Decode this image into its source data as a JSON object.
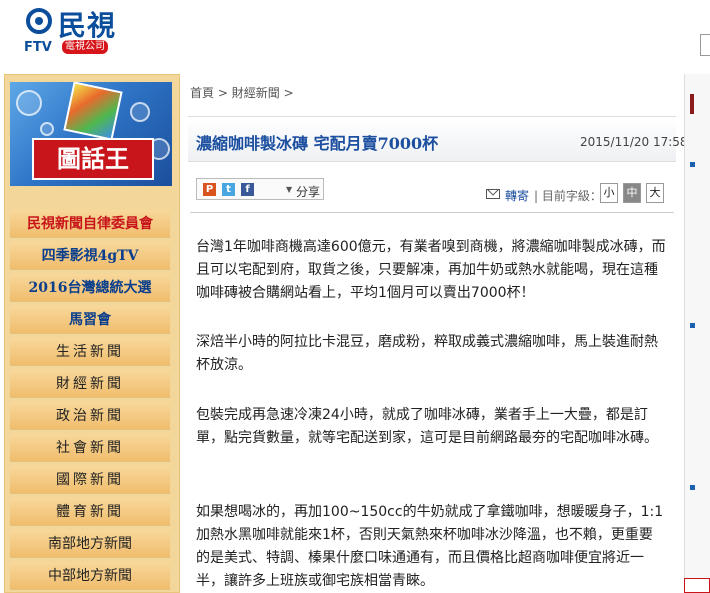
{
  "header": {
    "logo_text": "民視",
    "logo_ftv": "FTV",
    "logo_company": "電視公司"
  },
  "sidebar": {
    "banner_label": "圖話王",
    "items": [
      {
        "label": "民視新聞自律委員會"
      },
      {
        "label": "四季影視4gTV"
      },
      {
        "label": "2016台灣總統大選"
      },
      {
        "label": "馬習會"
      },
      {
        "label": "生活新聞"
      },
      {
        "label": "財經新聞"
      },
      {
        "label": "政治新聞"
      },
      {
        "label": "社會新聞"
      },
      {
        "label": "國際新聞"
      },
      {
        "label": "體育新聞"
      },
      {
        "label": "南部地方新聞"
      },
      {
        "label": "中部地方新聞"
      }
    ]
  },
  "breadcrumb": {
    "home": "首頁",
    "sep1": ">",
    "section": "財經新聞",
    "sep2": ">"
  },
  "article": {
    "title": "濃縮咖啡製冰磚 宅配月賣7000杯",
    "date": "2015/11/20 17:58",
    "paragraphs": [
      "台灣1年咖啡商機高達600億元，有業者嗅到商機，將濃縮咖啡製成冰磚，而且可以宅配到府，取貨之後，只要解凍，再加牛奶或熱水就能喝，現在這種咖啡磚被合購網站看上，平均1個月可以賣出7000杯！",
      "深焙半小時的阿拉比卡混豆，磨成粉，粹取成義式濃縮咖啡，馬上裝進耐熱杯放涼。",
      "包裝完成再急速冷凍24小時，就成了咖啡冰磚，業者手上一大疊，都是訂單，點完貨數量，就等宅配送到家，這可是目前網路最夯的宅配咖啡冰磚。",
      "如果想喝冰的，再加100~150cc的牛奶就成了拿鐵咖啡，想暖暖身子，1:1加熱水黑咖啡就能來1杯，否則天氣熱來杯咖啡冰沙降溫，也不賴，更重要的是美式、特調、榛果什麼口味通通有，而且價格比超商咖啡便宜將近一半，讓許多上班族或御宅族相當青睞。"
    ]
  },
  "toolbar": {
    "share_label": "分享",
    "share_arrow": "▼",
    "mail_label": "轉寄",
    "font_label": "| 目前字級：",
    "font_small": "小",
    "font_medium": "中",
    "font_large": "大",
    "share_icons": [
      {
        "name": "plurk-icon",
        "glyph": "P",
        "color": "#d9531e"
      },
      {
        "name": "twitter-icon",
        "glyph": "t",
        "color": "#49a6e0"
      },
      {
        "name": "facebook-icon",
        "glyph": "f",
        "color": "#3b5998"
      }
    ]
  }
}
